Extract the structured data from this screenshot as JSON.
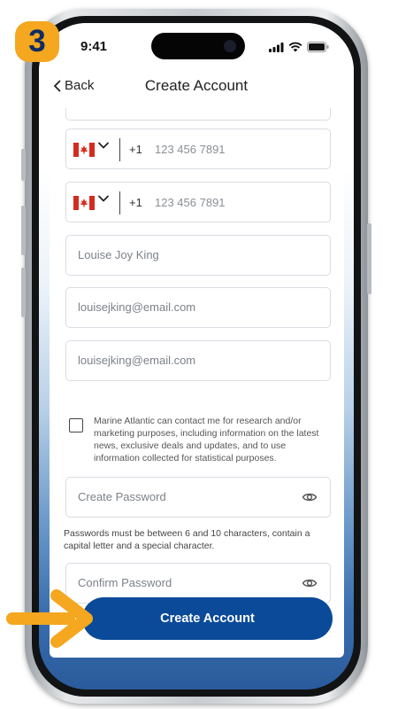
{
  "tutorial": {
    "step_number": "3"
  },
  "status_bar": {
    "time": "9:41"
  },
  "nav": {
    "back_label": "Back",
    "title": "Create Account"
  },
  "form": {
    "phone_primary": {
      "country_flag": "canada-flag-icon",
      "dial_code": "+1",
      "placeholder": "123 456 7891"
    },
    "phone_secondary": {
      "country_flag": "canada-flag-icon",
      "dial_code": "+1",
      "placeholder": "123 456 7891"
    },
    "full_name": {
      "placeholder": "Louise Joy King"
    },
    "email": {
      "placeholder": "louisejking@email.com"
    },
    "confirm_email": {
      "placeholder": "louisejking@email.com"
    },
    "marketing_consent": {
      "checked": false,
      "label": "Marine Atlantic can contact me for research and/or marketing purposes, including information on the latest news, exclusive deals and updates, and to use information collected for statistical purposes."
    },
    "password": {
      "placeholder": "Create Password",
      "toggle_icon": "eye-icon"
    },
    "password_hint": "Passwords must be between 6 and 10 characters, contain a capital letter and a special character.",
    "confirm_password": {
      "placeholder": "Confirm Password",
      "toggle_icon": "eye-icon"
    },
    "submit_label": "Create Account"
  },
  "colors": {
    "primary": "#0b4a99",
    "badge": "#f4a71f",
    "arrow": "#f4a71f"
  }
}
